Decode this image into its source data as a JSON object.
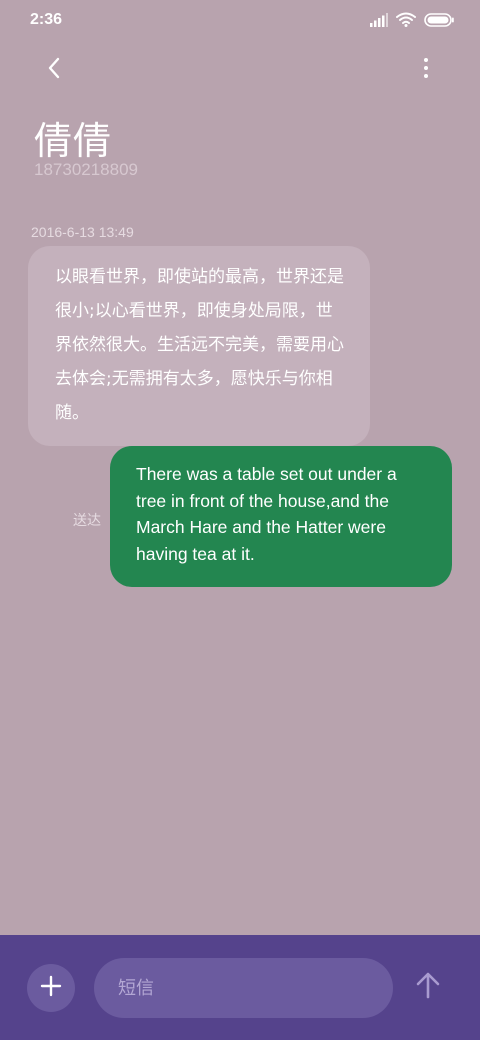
{
  "status_bar": {
    "time": "2:36",
    "icons": [
      "signal-icon",
      "wifi-icon",
      "battery-icon"
    ]
  },
  "header": {
    "back_icon": "chevron-left-icon",
    "more_icon": "more-vertical-icon",
    "contact_name": "倩倩",
    "contact_number": "18730218809"
  },
  "messages": {
    "timestamp": "2016-6-13 13:49",
    "incoming_text": "以眼看世界，即使站的最高，世界还是很小;以心看世界，即使身处局限，世界依然很大。生活远不完美，需要用心去体会;无需拥有太多，愿快乐与你相随。",
    "delivered_label": "送达",
    "outgoing_text": "There was a table set out under a tree in front of the house,and the March Hare and the Hatter were having tea at it."
  },
  "composer": {
    "add_icon": "plus-icon",
    "placeholder": "短信",
    "value": "",
    "send_icon": "arrow-up-icon"
  },
  "colors": {
    "background": "#b8a3ae",
    "incoming_bubble": "#c4b1bc",
    "outgoing_bubble": "#238650",
    "composer_bar": "#55438c",
    "composer_field": "#6b5b9f"
  }
}
